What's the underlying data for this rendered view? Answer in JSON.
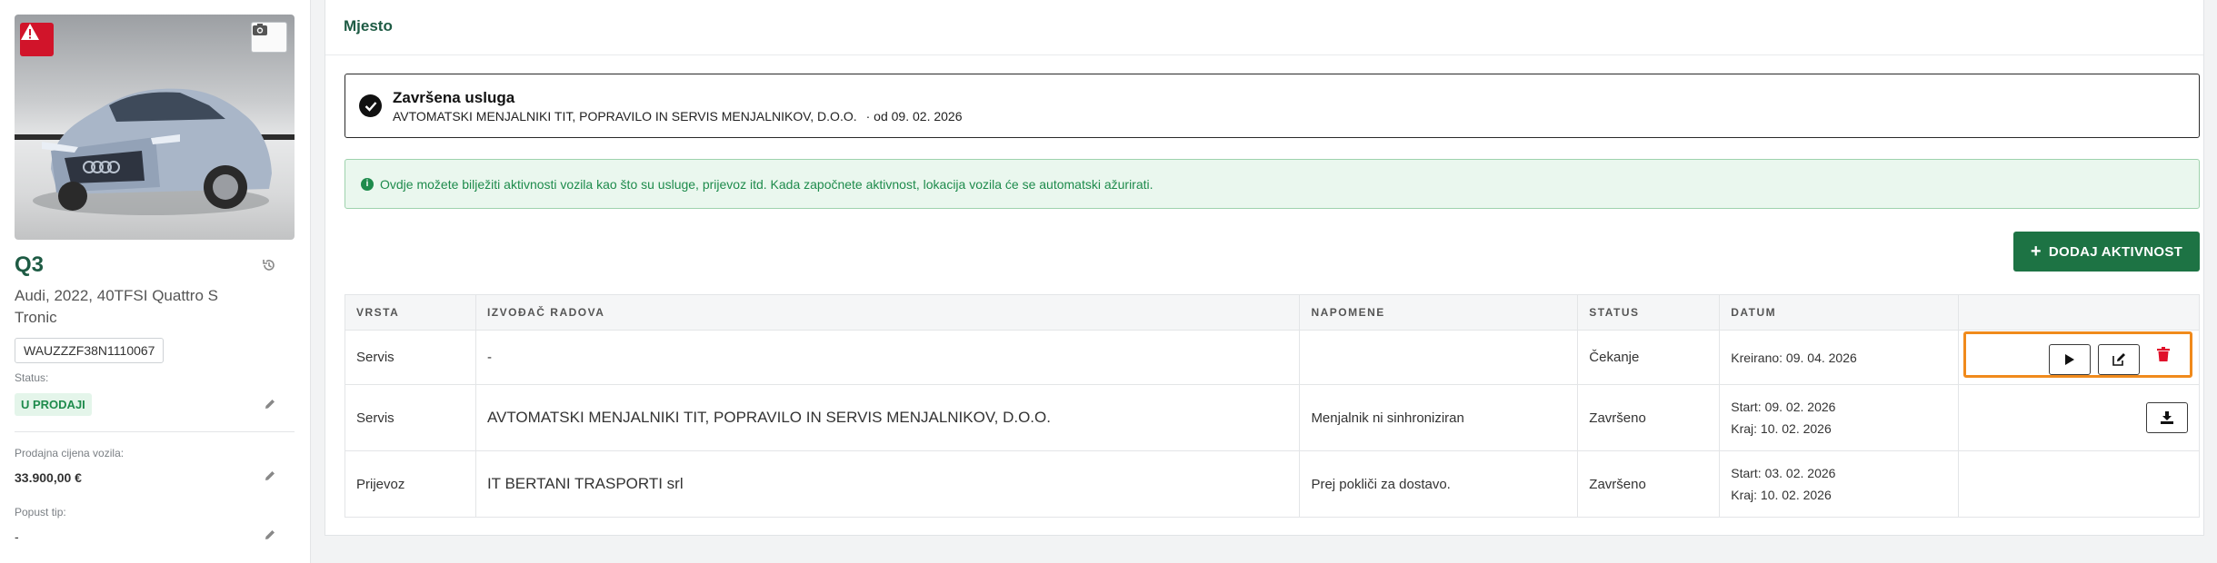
{
  "sidebar": {
    "model": "Q3",
    "description": "Audi, 2022, 40TFSI Quattro S Tronic",
    "vin": "WAUZZZF38N1110067",
    "status_label": "Status:",
    "status_value": "U PRODAJI",
    "price_label": "Prodajna cijena vozila:",
    "price_value": "33.900,00 €",
    "discount_label": "Popust tip:",
    "discount_value": "-"
  },
  "main": {
    "section_title": "Mjesto",
    "service": {
      "title": "Završena usluga",
      "company": "AVTOMATSKI MENJALNIKI TIT, POPRAVILO IN SERVIS MENJALNIKOV, D.O.O.",
      "since": "· od 09. 02. 2026"
    },
    "info": "Ovdje možete bilježiti aktivnosti vozila kao što su usluge, prijevoz itd. Kada započnete aktivnost, lokacija vozila će se automatski ažurirati.",
    "add_button": "DODAJ AKTIVNOST",
    "table": {
      "headers": [
        "VRSTA",
        "IZVOĐAČ RADOVA",
        "NAPOMENE",
        "STATUS",
        "DATUM",
        ""
      ],
      "rows": [
        {
          "type": "Servis",
          "contractor": "-",
          "notes": "",
          "status": "Čekanje",
          "date1": "Kreirano: 09. 04. 2026",
          "date2": ""
        },
        {
          "type": "Servis",
          "contractor": "AVTOMATSKI MENJALNIKI TIT, POPRAVILO IN SERVIS MENJALNIKOV, D.O.O.",
          "notes": "Menjalnik ni sinhroniziran",
          "status": "Završeno",
          "date1": "Start: 09. 02. 2026",
          "date2": "Kraj: 10. 02. 2026"
        },
        {
          "type": "Prijevoz",
          "contractor": "IT BERTANI TRASPORTI srl",
          "notes": "Prej pokliči za dostavo.",
          "status": "Završeno",
          "date1": "Start: 03. 02. 2026",
          "date2": "Kraj: 10. 02. 2026"
        }
      ]
    }
  },
  "colors": {
    "brand_green": "#1e5b44",
    "button_green": "#1d7344",
    "alert_red": "#d1142a",
    "highlight_orange": "#f08a1c",
    "info_green": "#1e8b4c"
  },
  "icons": [
    "warning-icon",
    "camera-icon",
    "history-icon",
    "pencil-icon",
    "check-icon",
    "info-icon",
    "plus-icon",
    "play-icon",
    "edit-icon",
    "trash-icon",
    "download-icon"
  ]
}
